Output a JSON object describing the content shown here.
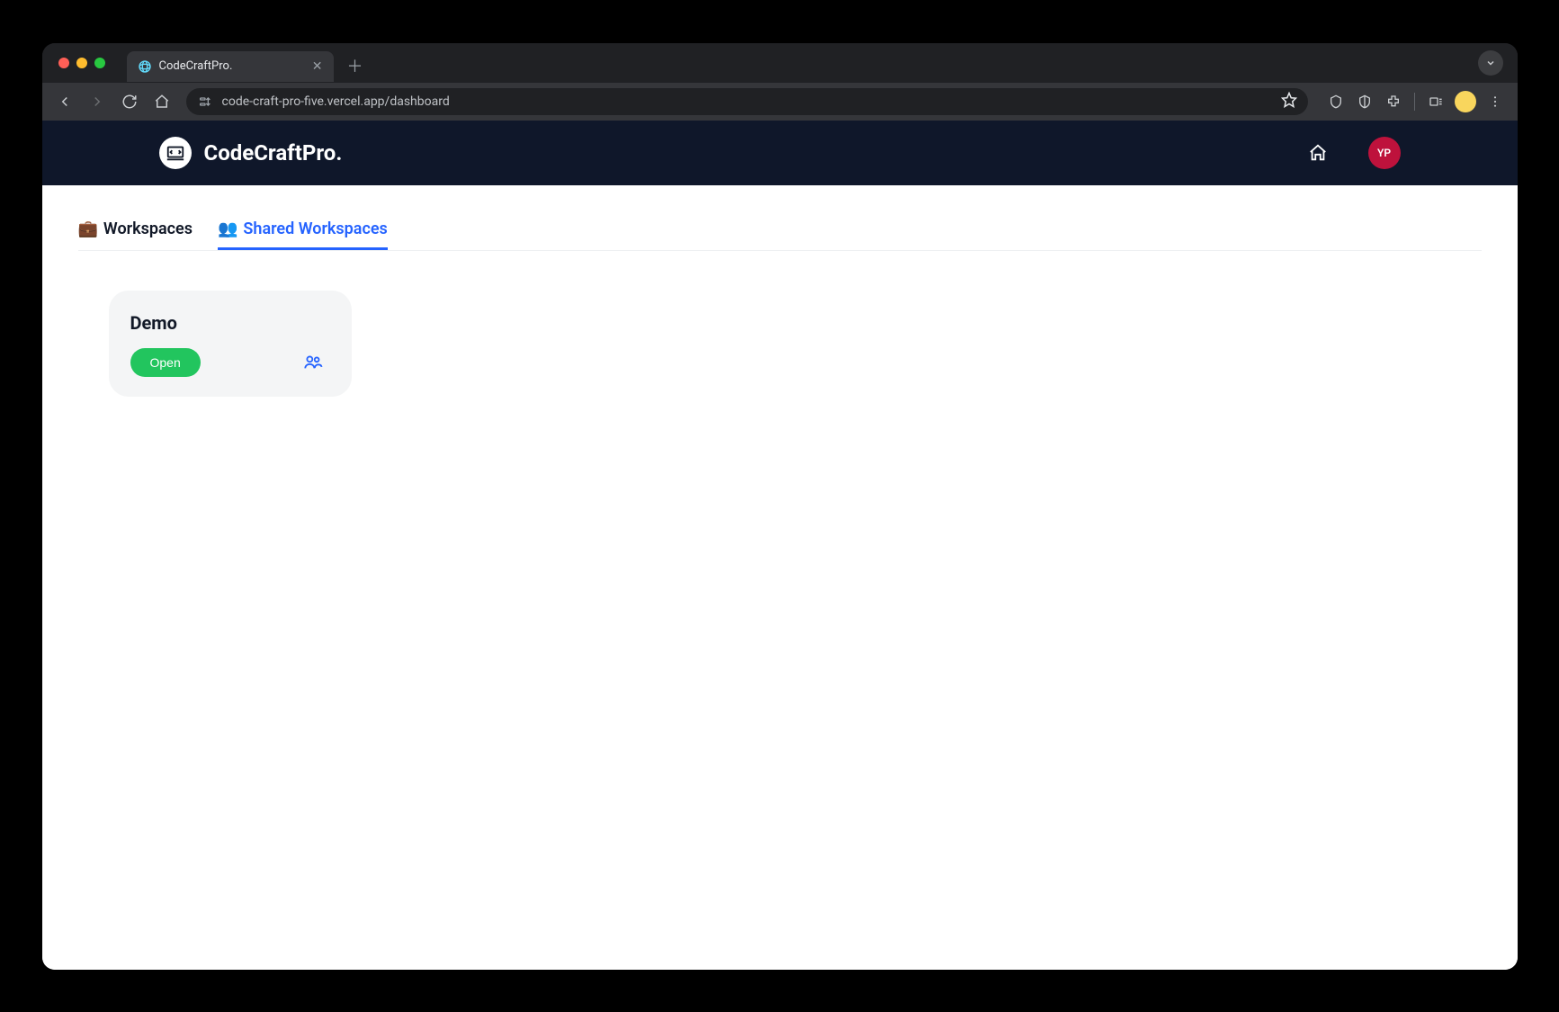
{
  "browser": {
    "tab_title": "CodeCraftPro.",
    "url": "code-craft-pro-five.vercel.app/dashboard"
  },
  "header": {
    "brand": "CodeCraftPro.",
    "avatar_initials": "YP"
  },
  "tabs": {
    "workspaces": {
      "emoji": "💼",
      "label": "Workspaces"
    },
    "shared": {
      "emoji": "👥",
      "label": "Shared Workspaces"
    }
  },
  "cards": [
    {
      "title": "Demo",
      "open_label": "Open"
    }
  ]
}
